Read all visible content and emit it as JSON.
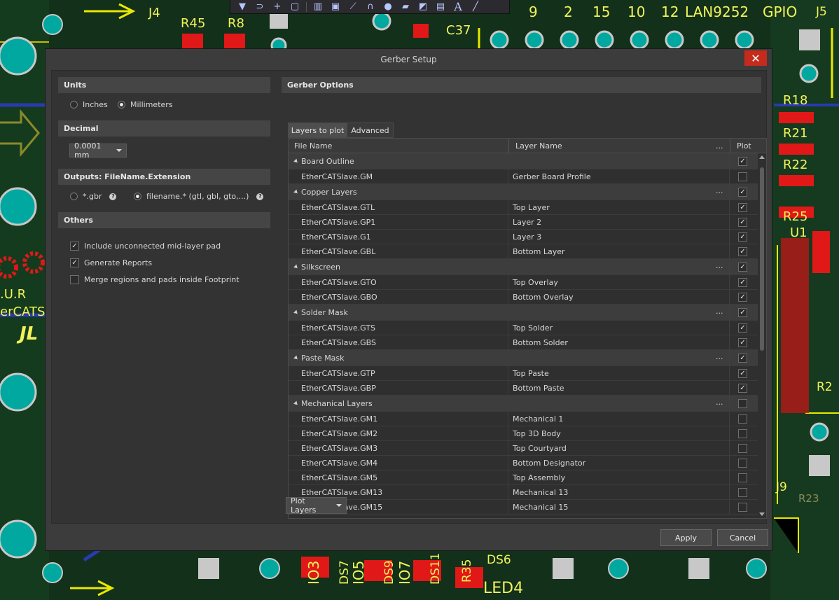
{
  "background": {
    "labels": [
      "J4",
      "R45",
      "R8",
      "C37",
      "9",
      "2",
      "15",
      "10",
      "12",
      "LAN9252",
      "GPIO",
      "J5",
      "R18",
      "R21",
      "R22",
      "R25",
      "U1",
      "R2",
      "J9",
      "R23",
      "IO3",
      "DS7",
      "IO5",
      "DS9",
      "IO7",
      "DS11",
      "R35",
      "DS6",
      "LED4",
      ".U.R",
      "erCATS",
      "JL"
    ]
  },
  "toolbar": {
    "icons": [
      "filter-icon",
      "route-icon",
      "plus-icon",
      "select-rect-icon",
      "chart-icon",
      "component-icon",
      "net-icon",
      "arc-icon",
      "pin-icon",
      "place-icon",
      "polygon-icon",
      "dimension-icon",
      "text-icon",
      "line-icon"
    ]
  },
  "dialog": {
    "title": "Gerber Setup",
    "close": "✕",
    "units": {
      "header": "Units",
      "options": [
        "Inches",
        "Millimeters"
      ],
      "selected": 1
    },
    "decimal": {
      "header": "Decimal",
      "value": "0.0001 mm"
    },
    "outputs": {
      "header": "Outputs: FileName.Extension",
      "options": [
        "*.gbr",
        "filename.* (gtl, gbl, gto,...)"
      ],
      "selected": 1
    },
    "others": {
      "header": "Others",
      "options": [
        {
          "label": "Include unconnected mid-layer pad",
          "checked": true
        },
        {
          "label": "Generate Reports",
          "checked": true
        },
        {
          "label": "Merge regions and pads inside Footprint",
          "checked": false
        }
      ]
    },
    "gerber_options": {
      "header": "Gerber Options",
      "tabs": [
        "Layers to plot",
        "Advanced"
      ],
      "active_tab": 0,
      "columns": {
        "file": "File Name",
        "layer": "Layer Name",
        "more": "...",
        "plot": "Plot"
      },
      "rows": [
        {
          "type": "group",
          "name": "Board Outline",
          "plot": true,
          "dots": false
        },
        {
          "type": "item",
          "file": "EtherCATSlave.GM",
          "layer": "Gerber Board Profile",
          "plot": false
        },
        {
          "type": "group",
          "name": "Copper Layers",
          "plot": true,
          "dots": true
        },
        {
          "type": "item",
          "file": "EtherCATSlave.GTL",
          "layer": "Top Layer",
          "plot": true
        },
        {
          "type": "item",
          "file": "EtherCATSlave.GP1",
          "layer": "Layer 2",
          "plot": true
        },
        {
          "type": "item",
          "file": "EtherCATSlave.G1",
          "layer": "Layer 3",
          "plot": true
        },
        {
          "type": "item",
          "file": "EtherCATSlave.GBL",
          "layer": "Bottom Layer",
          "plot": true
        },
        {
          "type": "group",
          "name": "Silkscreen",
          "plot": true,
          "dots": true
        },
        {
          "type": "item",
          "file": "EtherCATSlave.GTO",
          "layer": "Top Overlay",
          "plot": true
        },
        {
          "type": "item",
          "file": "EtherCATSlave.GBO",
          "layer": "Bottom Overlay",
          "plot": true
        },
        {
          "type": "group",
          "name": "Solder Mask",
          "plot": true,
          "dots": true
        },
        {
          "type": "item",
          "file": "EtherCATSlave.GTS",
          "layer": "Top Solder",
          "plot": true
        },
        {
          "type": "item",
          "file": "EtherCATSlave.GBS",
          "layer": "Bottom Solder",
          "plot": true
        },
        {
          "type": "group",
          "name": "Paste Mask",
          "plot": true,
          "dots": true
        },
        {
          "type": "item",
          "file": "EtherCATSlave.GTP",
          "layer": "Top Paste",
          "plot": true
        },
        {
          "type": "item",
          "file": "EtherCATSlave.GBP",
          "layer": "Bottom Paste",
          "plot": true
        },
        {
          "type": "group",
          "name": "Mechanical Layers",
          "plot": false,
          "dots": true
        },
        {
          "type": "item",
          "file": "EtherCATSlave.GM1",
          "layer": "Mechanical 1",
          "plot": false
        },
        {
          "type": "item",
          "file": "EtherCATSlave.GM2",
          "layer": "Top 3D Body",
          "plot": false
        },
        {
          "type": "item",
          "file": "EtherCATSlave.GM3",
          "layer": "Top Courtyard",
          "plot": false
        },
        {
          "type": "item",
          "file": "EtherCATSlave.GM4",
          "layer": "Bottom Designator",
          "plot": false
        },
        {
          "type": "item",
          "file": "EtherCATSlave.GM5",
          "layer": "Top Assembly",
          "plot": false
        },
        {
          "type": "item",
          "file": "EtherCATSlave.GM13",
          "layer": "Mechanical 13",
          "plot": false
        },
        {
          "type": "item",
          "file": "EtherCATSlave.GM15",
          "layer": "Mechanical 15",
          "plot": false
        }
      ],
      "plot_layers_button": "Plot Layers"
    },
    "buttons": {
      "apply": "Apply",
      "cancel": "Cancel"
    }
  }
}
